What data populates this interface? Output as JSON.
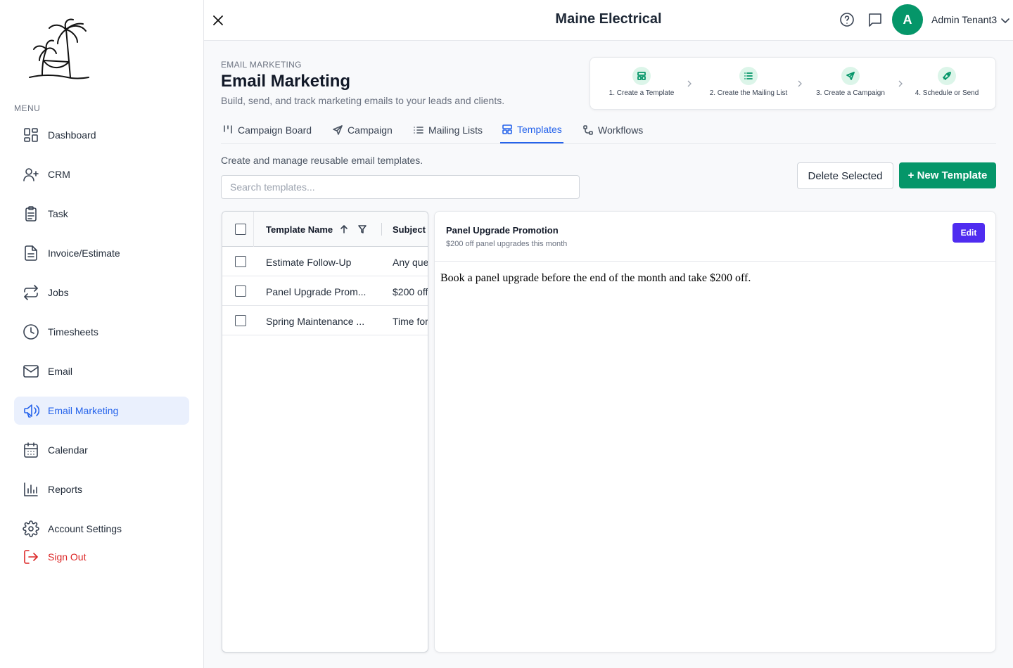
{
  "app": {
    "title": "Maine Electrical",
    "user_initial": "A",
    "user_name": "Admin Tenant3"
  },
  "colors": {
    "accent_green": "#059669",
    "active_blue": "#2563eb",
    "edit_purple": "#4f2cf0",
    "signout_red": "#dc2626"
  },
  "sidebar": {
    "menu_label": "MENU",
    "items": [
      {
        "label": "Dashboard",
        "icon": "dashboard-icon"
      },
      {
        "label": "CRM",
        "icon": "user-plus-icon"
      },
      {
        "label": "Task",
        "icon": "clipboard-icon"
      },
      {
        "label": "Invoice/Estimate",
        "icon": "document-icon"
      },
      {
        "label": "Jobs",
        "icon": "repeat-icon"
      },
      {
        "label": "Timesheets",
        "icon": "clock-icon"
      },
      {
        "label": "Email",
        "icon": "mail-icon"
      },
      {
        "label": "Email Marketing",
        "icon": "megaphone-icon",
        "active": true
      },
      {
        "label": "Calendar",
        "icon": "calendar-icon"
      },
      {
        "label": "Reports",
        "icon": "bar-chart-icon"
      },
      {
        "label": "Account Settings",
        "icon": "gear-icon"
      }
    ],
    "signout_label": "Sign Out"
  },
  "header": {
    "eyebrow": "EMAIL MARKETING",
    "title": "Email Marketing",
    "subtitle": "Build, send, and track marketing emails to your leads and clients."
  },
  "steps": [
    {
      "label": "1. Create a Template",
      "icon": "template-icon"
    },
    {
      "label": "2. Create the Mailing List",
      "icon": "list-icon"
    },
    {
      "label": "3. Create a Campaign",
      "icon": "send-icon"
    },
    {
      "label": "4. Schedule or Send",
      "icon": "rocket-icon"
    }
  ],
  "tabs": [
    {
      "label": "Campaign Board",
      "icon": "board-icon"
    },
    {
      "label": "Campaign",
      "icon": "send-icon"
    },
    {
      "label": "Mailing Lists",
      "icon": "list-icon"
    },
    {
      "label": "Templates",
      "icon": "template-icon",
      "active": true
    },
    {
      "label": "Workflows",
      "icon": "workflow-icon"
    }
  ],
  "templates": {
    "description": "Create and manage reusable email templates.",
    "search_placeholder": "Search templates...",
    "delete_label": "Delete Selected",
    "new_label": "+ New Template",
    "columns": {
      "name": "Template Name",
      "subject": "Subject"
    },
    "rows": [
      {
        "name": "Estimate Follow-Up",
        "subject": "Any que"
      },
      {
        "name": "Panel Upgrade Prom...",
        "subject": "$200 off"
      },
      {
        "name": "Spring Maintenance ...",
        "subject": "Time for"
      }
    ]
  },
  "preview": {
    "title": "Panel Upgrade Promotion",
    "subtitle": "$200 off panel upgrades this month",
    "edit_label": "Edit",
    "body": "Book a panel upgrade before the end of the month and take $200 off."
  }
}
